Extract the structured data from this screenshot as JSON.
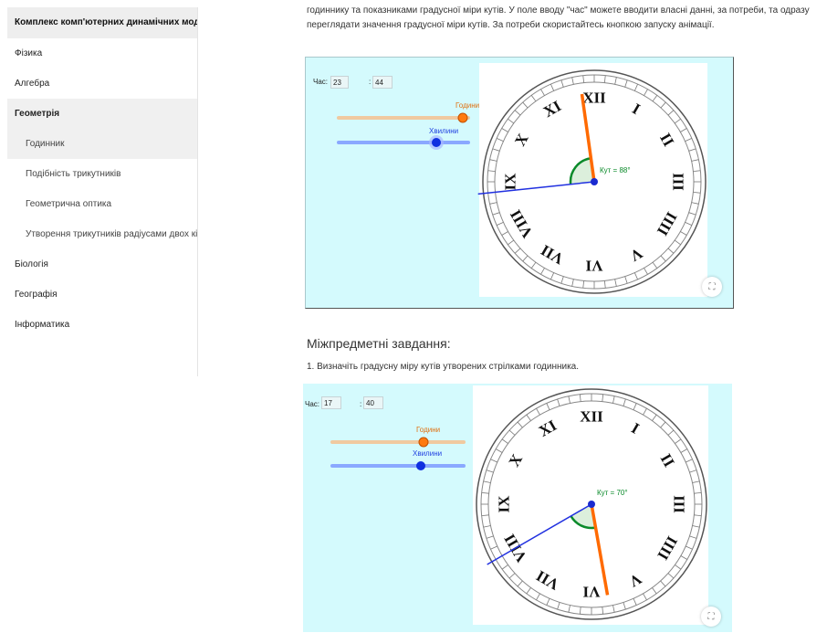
{
  "sidebar": {
    "title": "Комплекс комп'ютерних динамічних мод",
    "items": [
      {
        "label": "Фізика"
      },
      {
        "label": "Алгебра"
      },
      {
        "label": "Геометрія"
      },
      {
        "label": "Годинник"
      },
      {
        "label": "Подібність трикутників"
      },
      {
        "label": "Геометрична оптика"
      },
      {
        "label": "Утворення трикутників радіусами двох кіл"
      },
      {
        "label": "Біологія"
      },
      {
        "label": "Географія"
      },
      {
        "label": "Інформатика"
      }
    ]
  },
  "intro": {
    "line1": "годиннику та показниками градусної міри кутів. У поле вводу \"час\" можете вводити власні данні, за потреби, та одразу",
    "line2": "переглядати значення градусної міри кутів. За потреби скористайтесь кнопкою запуску анімації."
  },
  "applet1": {
    "hour_label": "Час:",
    "hour_value": "23",
    "minute_sep": ":",
    "minute_value": "44",
    "slider_hours_label": "Години",
    "slider_minutes_label": "Хвилини",
    "angle_label": "Кут = 88°"
  },
  "section": {
    "title": "Міжпредметні завдання:",
    "task1": "1. Визначіть градусну міру кутів утворених стрілками годинника."
  },
  "applet2": {
    "hour_label": "Час:",
    "hour_value": "17",
    "minute_sep": ":",
    "minute_value": "40",
    "slider_hours_label": "Години",
    "slider_minutes_label": "Хвилини",
    "angle_label": "Кут = 70°"
  },
  "numerals": [
    "XII",
    "I",
    "II",
    "III",
    "IIII",
    "V",
    "VI",
    "VII",
    "VIII",
    "IX",
    "X",
    "XI"
  ],
  "colors": {
    "applet_bg": "#d4fafd",
    "hour_hand": "#ff6a00",
    "minute_hand": "#2030e0",
    "angle_arc": "#0a8a2a",
    "slider_hours": "#f0c9a0",
    "slider_minutes": "#8aa8ff"
  }
}
